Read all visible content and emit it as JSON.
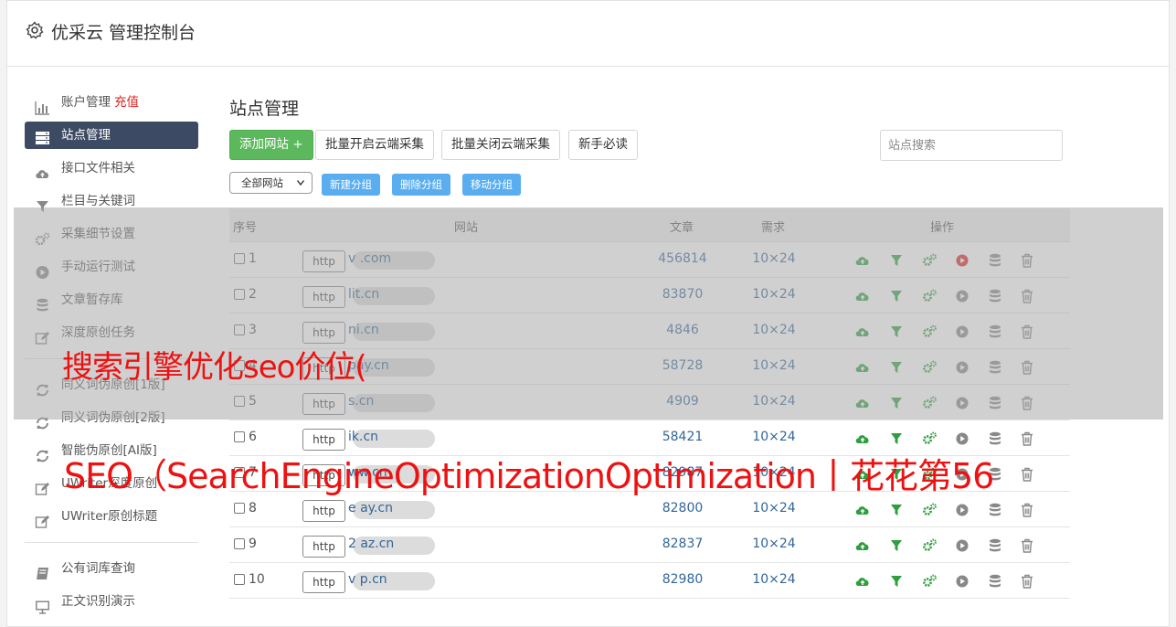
{
  "header": {
    "title": "优采云 管理控制台"
  },
  "sidebar": {
    "group1": [
      {
        "label": "账户管理",
        "badge": "充值",
        "icon": "bar-chart-icon",
        "active": false
      },
      {
        "label": "站点管理",
        "icon": "server-icon",
        "active": true
      },
      {
        "label": "接口文件相关",
        "icon": "cloud-upload-icon",
        "active": false
      },
      {
        "label": "栏目与关键词",
        "icon": "filter-icon",
        "active": false
      },
      {
        "label": "采集细节设置",
        "icon": "gears-icon",
        "active": false
      },
      {
        "label": "手动运行测试",
        "icon": "play-circle-icon",
        "active": false
      },
      {
        "label": "文章暂存库",
        "icon": "database-icon",
        "active": false
      },
      {
        "label": "深度原创任务",
        "icon": "edit-icon",
        "active": false
      }
    ],
    "group2": [
      {
        "label": "同义词伪原创[1版]",
        "icon": "refresh-icon"
      },
      {
        "label": "同义词伪原创[2版]",
        "icon": "refresh-icon"
      },
      {
        "label": "智能伪原创[AI版]",
        "icon": "refresh-icon"
      },
      {
        "label": "UWriter深度原创",
        "icon": "edit-icon"
      },
      {
        "label": "UWriter原创标题",
        "icon": "edit-icon"
      }
    ],
    "group3": [
      {
        "label": "公有词库查询",
        "icon": "book-icon"
      },
      {
        "label": "正文识别演示",
        "icon": "monitor-icon"
      }
    ]
  },
  "main": {
    "title": "站点管理",
    "buttons": {
      "add": "添加网站 +",
      "batch_open": "批量开启云端采集",
      "batch_close": "批量关闭云端采集",
      "guide": "新手必读"
    },
    "search_placeholder": "站点搜索",
    "group_select": "全部网站",
    "group_buttons": {
      "new": "新建分组",
      "delete": "删除分组",
      "move": "移动分组"
    }
  },
  "table": {
    "headers": {
      "index": "序号",
      "site": "网站",
      "articles": "文章",
      "demand": "需求",
      "ops": "操作"
    },
    "rows": [
      {
        "n": "1",
        "proto": "http",
        "site": "v                .com",
        "articles": "456814",
        "demand": "10×24",
        "running": true
      },
      {
        "n": "2",
        "proto": "http",
        "site": "          lit.cn",
        "articles": "83870",
        "demand": "10×24",
        "running": false
      },
      {
        "n": "3",
        "proto": "http",
        "site": "          ni.cn",
        "articles": "4846",
        "demand": "10×24",
        "running": false
      },
      {
        "n": "4",
        "proto": "http",
        "site": "          pay.cn",
        "articles": "58728",
        "demand": "10×24",
        "running": false
      },
      {
        "n": "5",
        "proto": "http",
        "site": "          s.cn",
        "articles": "4909",
        "demand": "10×24",
        "running": false
      },
      {
        "n": "6",
        "proto": "http",
        "site": "       ik.cn",
        "articles": "58421",
        "demand": "10×24",
        "running": false
      },
      {
        "n": "7",
        "proto": "http",
        "site": "      ww.cn",
        "articles": "82987",
        "demand": "10×24",
        "running": false
      },
      {
        "n": "8",
        "proto": "http",
        "site": "e        ay.cn",
        "articles": "82800",
        "demand": "10×24",
        "running": false
      },
      {
        "n": "9",
        "proto": "http",
        "site": "2       az.cn",
        "articles": "82837",
        "demand": "10×24",
        "running": false
      },
      {
        "n": "10",
        "proto": "http",
        "site": "v       p.cn",
        "articles": "82980",
        "demand": "10×24",
        "running": false
      }
    ]
  },
  "watermark": {
    "line1": "搜索引擎优化seo价位(",
    "line2": "SEO（SearchEngineOptimizationOptimization丨花花第56"
  },
  "colors": {
    "primary_dark": "#3d4a63",
    "green": "#5cb85c",
    "blue_btn": "#5aaef0",
    "link": "#336699",
    "red": "#e02020"
  }
}
